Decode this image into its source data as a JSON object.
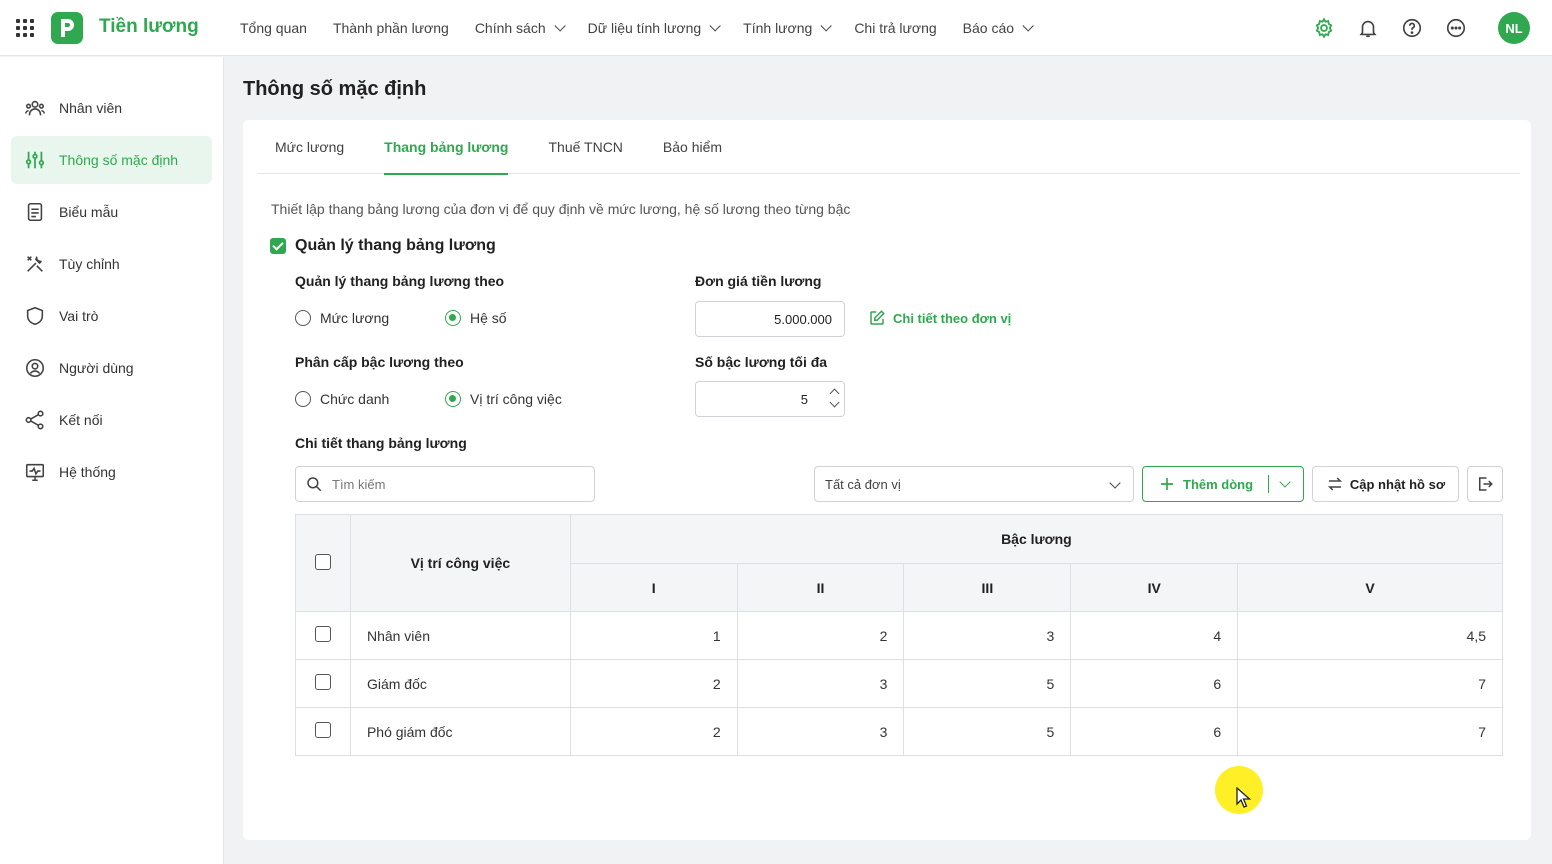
{
  "app": {
    "brand": "Tiền lương",
    "logo_letter": "P",
    "accent": "#2fa84f",
    "user_initials": "NL"
  },
  "nav": [
    {
      "label": "Tổng quan",
      "dropdown": false
    },
    {
      "label": "Thành phần lương",
      "dropdown": false
    },
    {
      "label": "Chính sách",
      "dropdown": true
    },
    {
      "label": "Dữ liệu tính lương",
      "dropdown": true
    },
    {
      "label": "Tính lương",
      "dropdown": true
    },
    {
      "label": "Chi trả lương",
      "dropdown": false
    },
    {
      "label": "Báo cáo",
      "dropdown": true
    }
  ],
  "sidebar": {
    "items": [
      {
        "label": "Nhân viên",
        "icon": "employees-icon",
        "active": false
      },
      {
        "label": "Thông số mặc định",
        "icon": "sliders-icon",
        "active": true
      },
      {
        "label": "Biểu mẫu",
        "icon": "document-icon",
        "active": false
      },
      {
        "label": "Tùy chỉnh",
        "icon": "tools-icon",
        "active": false
      },
      {
        "label": "Vai trò",
        "icon": "shield-icon",
        "active": false
      },
      {
        "label": "Người dùng",
        "icon": "user-circle-icon",
        "active": false
      },
      {
        "label": "Kết nối",
        "icon": "share-icon",
        "active": false
      },
      {
        "label": "Hệ thống",
        "icon": "monitor-icon",
        "active": false
      }
    ]
  },
  "page": {
    "title": "Thông số mặc định",
    "tabs": [
      "Mức lương",
      "Thang bảng lương",
      "Thuế TNCN",
      "Bảo hiểm"
    ],
    "active_tab": 1,
    "description": "Thiết lập thang bảng lương của đơn vị để quy định về mức lương, hệ số lương theo từng bậc",
    "manage_label": "Quản lý thang bảng lương",
    "manage_checked": true
  },
  "form": {
    "manage_by_label": "Quản lý thang bảng lương theo",
    "manage_by_options": [
      "Mức lương",
      "Hệ số"
    ],
    "manage_by_selected": 1,
    "unit_price_label": "Đơn giá tiền lương",
    "unit_price_value": "5.000.000",
    "detail_link": "Chi tiết theo đơn vị",
    "grade_by_label": "Phân cấp bậc lương theo",
    "grade_by_options": [
      "Chức danh",
      "Vị trí công việc"
    ],
    "grade_by_selected": 1,
    "max_grade_label": "Số bậc lương tối đa",
    "max_grade_value": "5"
  },
  "detail": {
    "title": "Chi tiết thang bảng lương",
    "search_placeholder": "Tìm kiếm",
    "unit_filter": "Tất cả đơn vị",
    "add_row": "Thêm dòng",
    "update_profile": "Cập nhật hồ sơ"
  },
  "table": {
    "col_position": "Vị trí công việc",
    "col_grade_group": "Bậc lương",
    "grades": [
      "I",
      "II",
      "III",
      "IV",
      "V"
    ],
    "rows": [
      {
        "name": "Nhân viên",
        "values": [
          "1",
          "2",
          "3",
          "4",
          "4,5"
        ]
      },
      {
        "name": "Giám đốc",
        "values": [
          "2",
          "3",
          "5",
          "6",
          "7"
        ]
      },
      {
        "name": "Phó giám đốc",
        "values": [
          "2",
          "3",
          "5",
          "6",
          "7"
        ]
      }
    ]
  }
}
